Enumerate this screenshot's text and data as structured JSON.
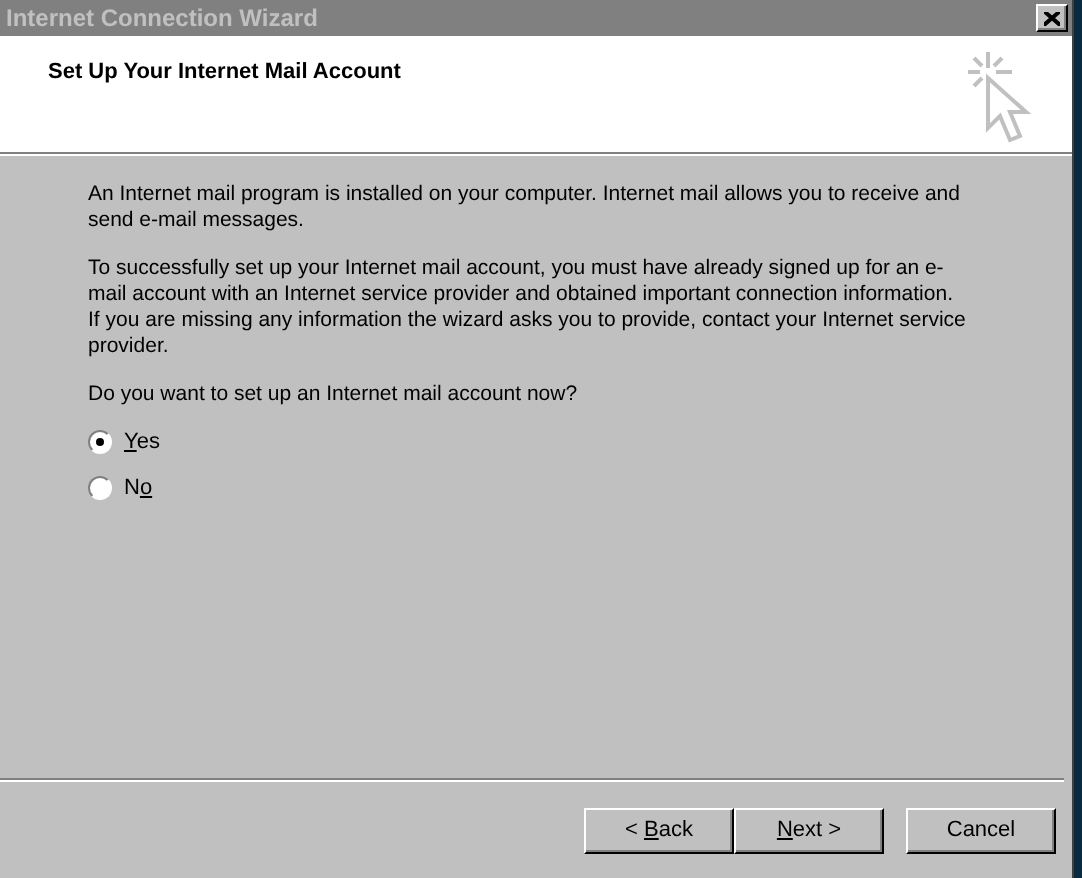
{
  "window": {
    "title": "Internet Connection Wizard"
  },
  "header": {
    "title": "Set Up Your Internet Mail Account"
  },
  "paragraphs": [
    "An Internet mail program is installed on your computer. Internet mail allows you to receive and send e-mail messages.",
    "To successfully set up your Internet mail account, you must have already signed up for an e-mail account with an Internet service provider and obtained important connection information. If you are missing any information the wizard asks you to provide, contact your Internet service provider.",
    "Do you want to set up an Internet mail account now?"
  ],
  "options": [
    {
      "access_key": "Y",
      "label_after": "es",
      "selected": true
    },
    {
      "label_before": "N",
      "access_key": "o",
      "selected": false
    }
  ],
  "buttons": [
    {
      "label_before": "< ",
      "access_key": "B",
      "label_after": "ack",
      "kind": "back"
    },
    {
      "access_key": "N",
      "label_after": "ext >",
      "kind": "next"
    },
    {
      "label": "Cancel",
      "kind": "cancel"
    }
  ]
}
